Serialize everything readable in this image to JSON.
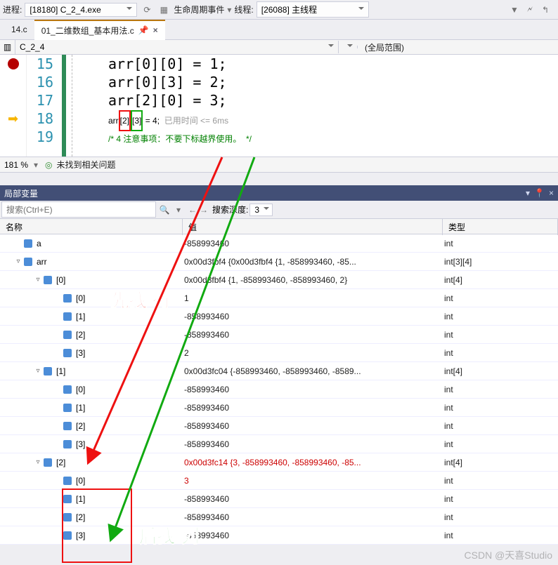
{
  "topbar": {
    "process_label": "进程:",
    "process_value": "[18180] C_2_4.exe",
    "lifecycle_label": "生命周期事件",
    "thread_label": "线程:",
    "thread_value": "[26088] 主线程"
  },
  "tabs": {
    "inactive": "14.c",
    "active": "01_二维数组_基本用法.c"
  },
  "navbar": {
    "module": "C_2_4",
    "scope": "(全局范围)"
  },
  "code": {
    "lines": [
      "15",
      "16",
      "17",
      "18",
      "19"
    ],
    "l15": "arr[0][0] = 1;",
    "l16": "arr[0][3] = 2;",
    "l17": "arr[2][0] = 3;",
    "l18_a": "arr",
    "l18_b": "[2]",
    "l18_c": "[3]",
    "l18_d": " = 4;",
    "l18_hint": "  已用时间 <= 6ms",
    "l19": "/* 4 注意事项：不要下标越界使用。  */"
  },
  "zoom": {
    "pct": "181 %",
    "msg": "未找到相关问题"
  },
  "locals": {
    "title": "局部变量",
    "search_ph": "搜索(Ctrl+E)",
    "depth_label": "搜索深度:",
    "depth_value": "3",
    "cols": {
      "name": "名称",
      "value": "值",
      "type": "类型"
    },
    "rows": [
      {
        "d": 0,
        "tw": "",
        "name": "a",
        "val": "-858993460",
        "typ": "int",
        "red": false
      },
      {
        "d": 0,
        "tw": "▿",
        "name": "arr",
        "val": "0x00d3fbf4 {0x00d3fbf4 {1, -858993460, -85...",
        "typ": "int[3][4]",
        "red": false
      },
      {
        "d": 1,
        "tw": "▿",
        "name": "[0]",
        "val": "0x00d3fbf4 {1, -858993460, -858993460, 2}",
        "typ": "int[4]",
        "red": false
      },
      {
        "d": 2,
        "tw": "",
        "name": "[0]",
        "val": "1",
        "typ": "int",
        "red": false
      },
      {
        "d": 2,
        "tw": "",
        "name": "[1]",
        "val": "-858993460",
        "typ": "int",
        "red": false
      },
      {
        "d": 2,
        "tw": "",
        "name": "[2]",
        "val": "-858993460",
        "typ": "int",
        "red": false
      },
      {
        "d": 2,
        "tw": "",
        "name": "[3]",
        "val": "2",
        "typ": "int",
        "red": false
      },
      {
        "d": 1,
        "tw": "▿",
        "name": "[1]",
        "val": "0x00d3fc04 {-858993460, -858993460, -8589...",
        "typ": "int[4]",
        "red": false
      },
      {
        "d": 2,
        "tw": "",
        "name": "[0]",
        "val": "-858993460",
        "typ": "int",
        "red": false
      },
      {
        "d": 2,
        "tw": "",
        "name": "[1]",
        "val": "-858993460",
        "typ": "int",
        "red": false
      },
      {
        "d": 2,
        "tw": "",
        "name": "[2]",
        "val": "-858993460",
        "typ": "int",
        "red": false
      },
      {
        "d": 2,
        "tw": "",
        "name": "[3]",
        "val": "-858993460",
        "typ": "int",
        "red": false
      },
      {
        "d": 1,
        "tw": "▿",
        "name": "[2]",
        "val": "0x00d3fc14 {3, -858993460, -858993460, -85...",
        "typ": "int[4]",
        "red": true
      },
      {
        "d": 2,
        "tw": "",
        "name": "[0]",
        "val": "3",
        "typ": "int",
        "red": true
      },
      {
        "d": 2,
        "tw": "",
        "name": "[1]",
        "val": "-858993460",
        "typ": "int",
        "red": false
      },
      {
        "d": 2,
        "tw": "",
        "name": "[2]",
        "val": "-858993460",
        "typ": "int",
        "red": false
      },
      {
        "d": 2,
        "tw": "",
        "name": "[3]",
        "val": "-858993460",
        "typ": "int",
        "red": false
      }
    ]
  },
  "annot": {
    "row": "先找 行",
    "col": "后找 列"
  },
  "watermark": "CSDN @天喜Studio"
}
